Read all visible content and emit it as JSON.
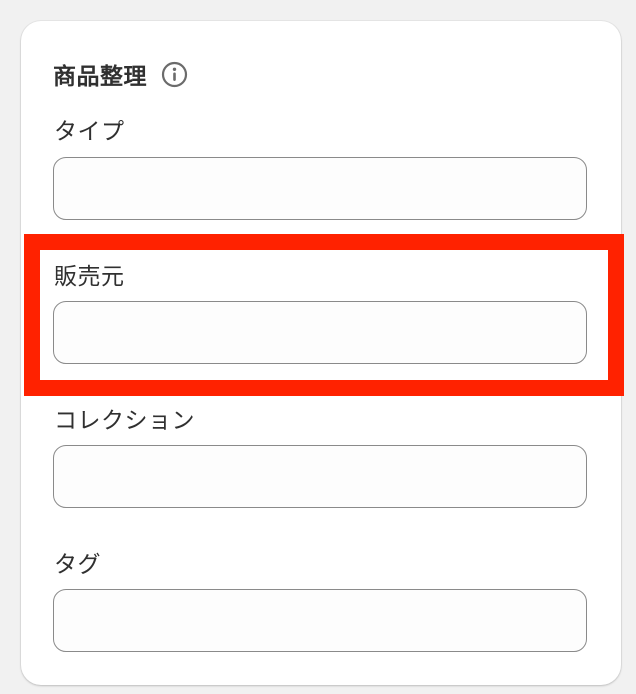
{
  "section": {
    "title": "商品整理",
    "info_icon": "info-circle-icon"
  },
  "fields": {
    "type": {
      "label": "タイプ",
      "value": ""
    },
    "vendor": {
      "label": "販売元",
      "value": ""
    },
    "collection": {
      "label": "コレクション",
      "value": ""
    },
    "tags": {
      "label": "タグ",
      "value": ""
    }
  },
  "colors": {
    "highlight": "#ff2200",
    "background": "#f1f1f1",
    "card": "#ffffff",
    "input_border": "#8a8a8a"
  }
}
